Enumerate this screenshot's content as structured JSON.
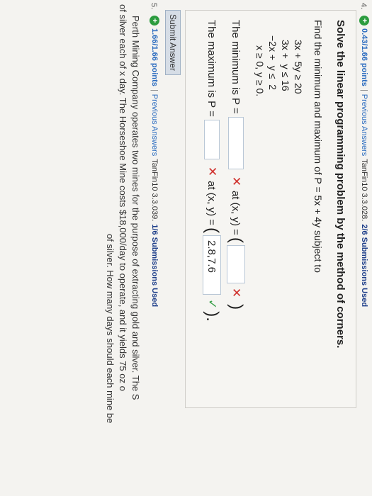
{
  "q4": {
    "number": "4.",
    "points": "0.43/1.66 points",
    "separator": "|",
    "prev_answers": "Previous Answers",
    "problem_id": "TanFin10 3.3.028.",
    "submissions": "2/6 Submissions Used",
    "title": "Solve the linear programming problem by the method of corners.",
    "prompt": "Find the minimum and maximum of P = 5x + 4y subject to",
    "constraints": [
      "3x + 5y ≥ 20",
      "3x +  y ≤ 16",
      "−2x +  y ≤  2",
      "x ≥ 0, y ≥ 0."
    ],
    "min_label": "The minimum is P =",
    "min_value": "",
    "max_label": "The maximum is P =",
    "max_value": "",
    "at_label": "at (x, y) =",
    "min_coord_value": "",
    "max_coord_value": "2.8,7.6",
    "submit_label": "Submit Answer",
    "icon_plus": "+",
    "x_mark": "✕",
    "check_mark": "✓",
    "paren_open": "(",
    "paren_close": ")",
    "paren_close_max": ")."
  },
  "q5": {
    "number": "5.",
    "points": "1.66/1.66 points",
    "separator": "|",
    "prev_answers": "Previous Answers",
    "problem_id": "TanFin10 3.3.039.",
    "submissions": "1/6 Submissions Used",
    "text_line1": "Perth Mining Company operates two mines for the purpose of extracting gold and silver. The S",
    "text_line2": "of silver each of x day. The Horseshoe Mine costs $18,000/day to operate, and it yields 75 oz o",
    "text_line3": "of silver. How many days should each mine be",
    "icon_plus": "+"
  },
  "colors": {
    "accent_link": "#2a6bbf",
    "correct_green": "#3aa04a",
    "wrong_red": "#d0312d",
    "points_icon": "#2c9c3f"
  }
}
